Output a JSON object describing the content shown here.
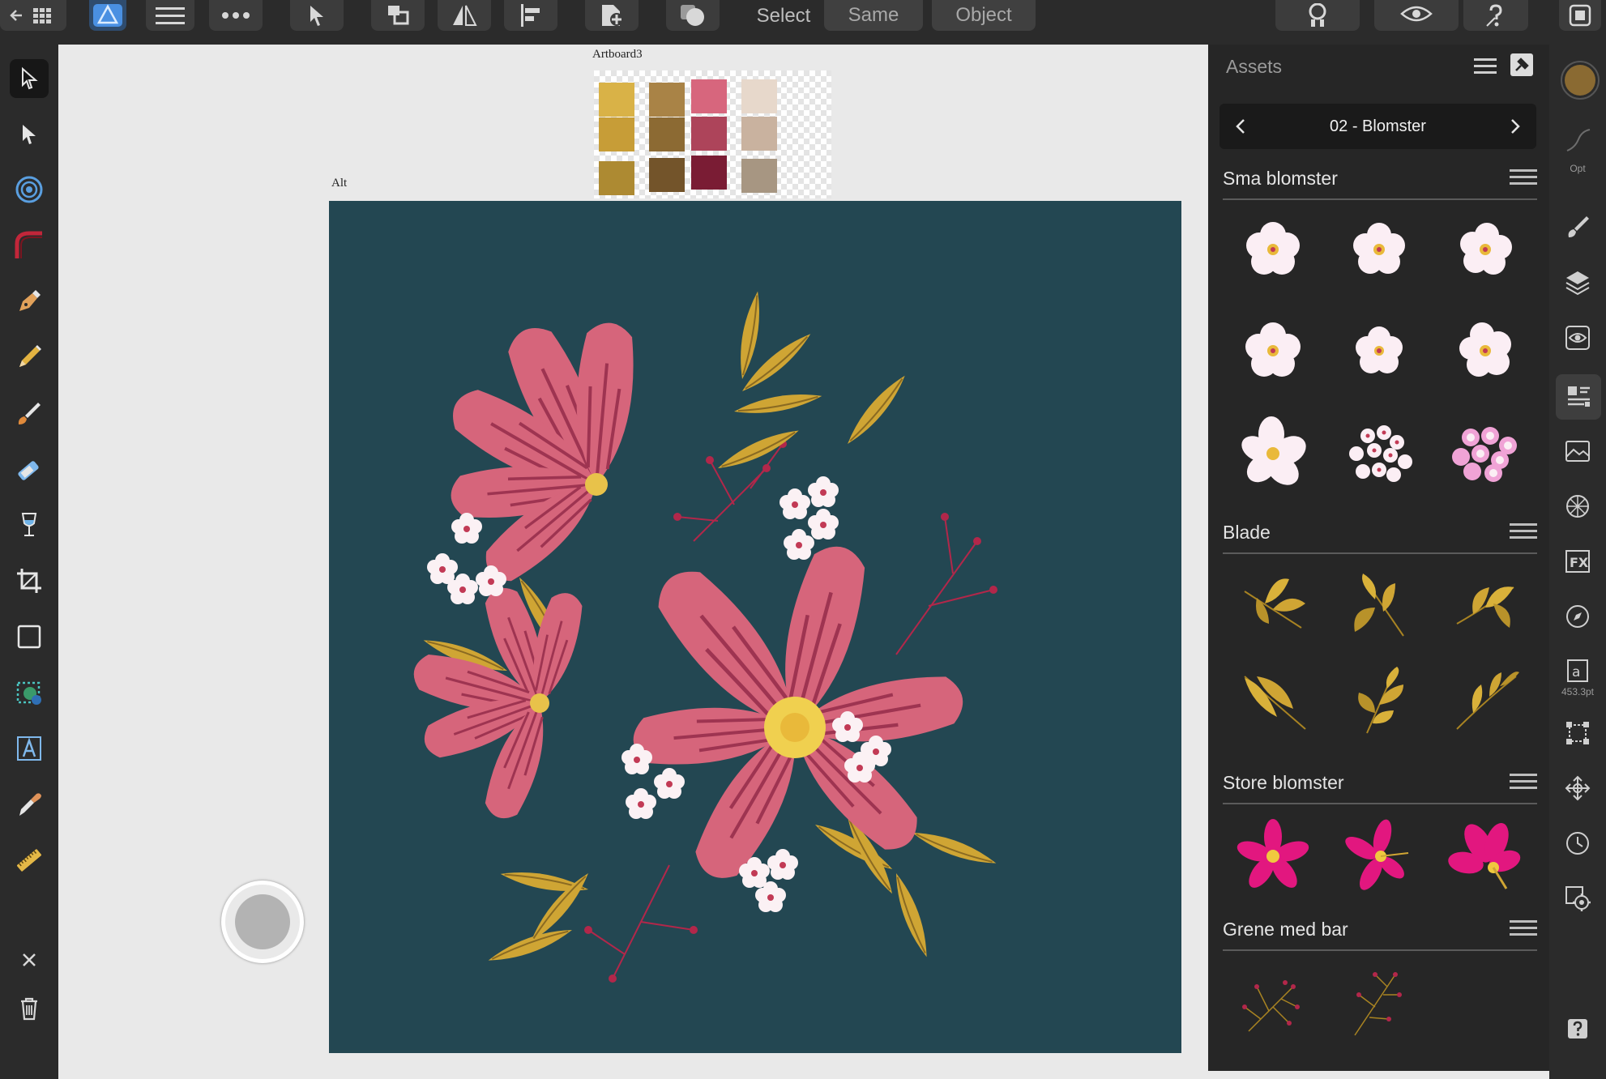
{
  "toolbar": {
    "select_label": "Select",
    "same_label": "Same",
    "object_label": "Object"
  },
  "canvas": {
    "artboard_swatches_label": "Artboard3",
    "artboard_main_label": "Alt",
    "swatch_colors": [
      "#d9b247",
      "#a98346",
      "#d7667d",
      "#e7d8cb",
      "#c79d37",
      "#8c6a33",
      "#ad445a",
      "#c9b29f",
      "#ad8a32",
      "#73542a",
      "#7a1c34",
      "#a79682"
    ]
  },
  "assets": {
    "title": "Assets",
    "category": "02 - Blomster",
    "sections": [
      {
        "title": "Sma blomster"
      },
      {
        "title": "Blade"
      },
      {
        "title": "Store blomster"
      },
      {
        "title": "Grene med bar"
      }
    ]
  },
  "studio": {
    "opt_label": "Opt",
    "font_size_label": "453.3pt",
    "brush_color": "#8a6a32"
  },
  "colors": {
    "accent": "#4a90e2",
    "artboard_bg": "#234752",
    "petal": "#d6657b",
    "leaf": "#cfa534"
  },
  "icons": [
    "grid-back-icon",
    "affinity-designer-logo",
    "hamburger-menu-icon",
    "more-icon",
    "move-tool-icon",
    "arrange-icon",
    "flip-icon",
    "align-icon",
    "insert-icon",
    "boolean-icon",
    "snapping-icon",
    "view-mode-icon",
    "help-icon",
    "persona-icon"
  ]
}
